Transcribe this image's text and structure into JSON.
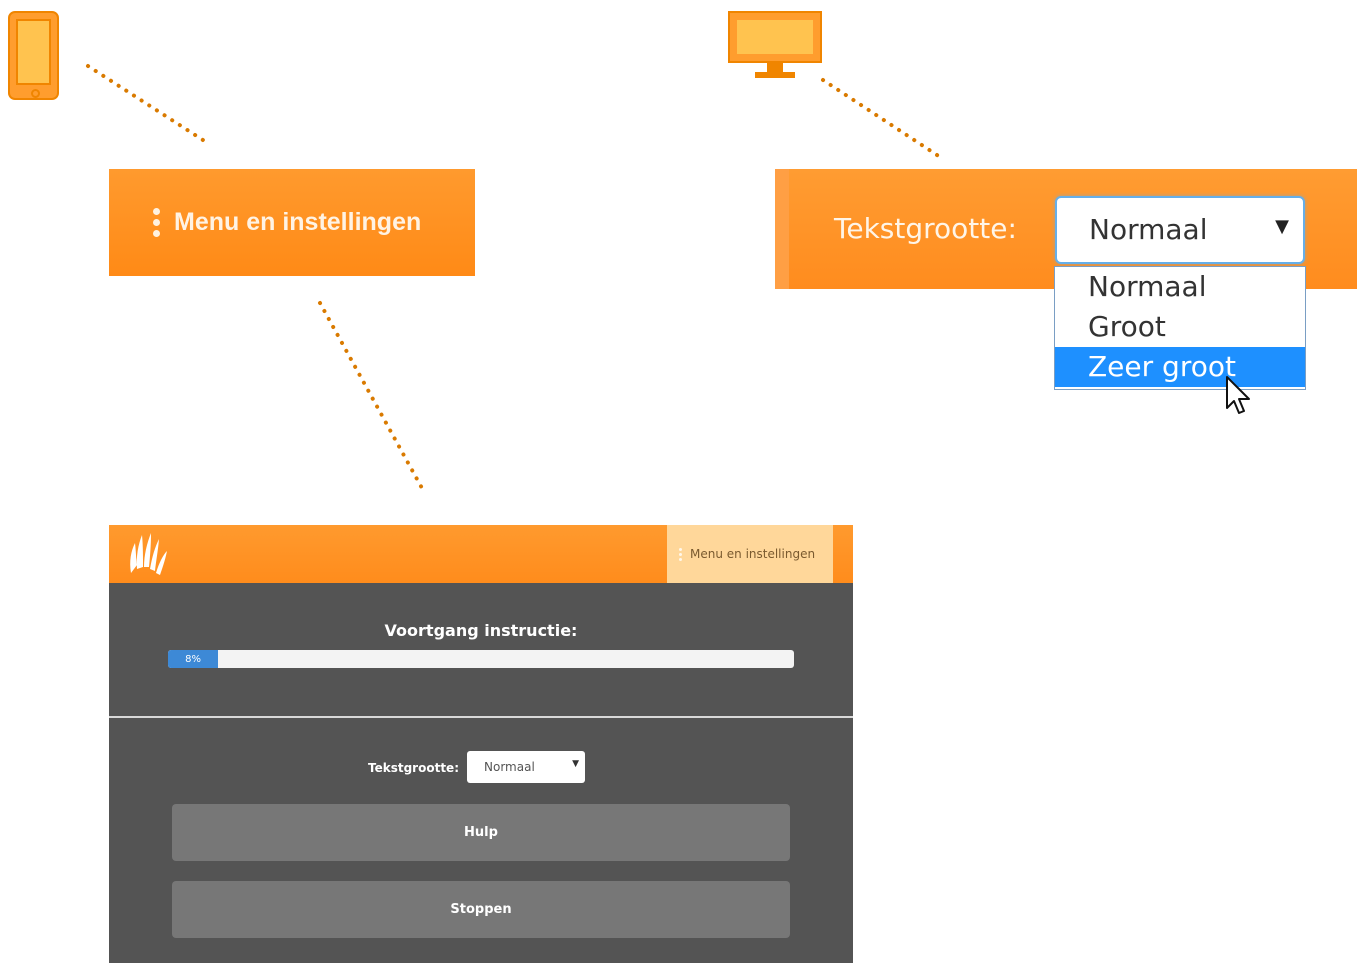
{
  "icons": {
    "phone": "phone-icon",
    "monitor": "monitor-icon",
    "kebab": "vertical-dots-icon",
    "cursor": "mouse-pointer-icon",
    "logo": "hands-logo-icon"
  },
  "colors": {
    "brand_orange": "#ff8c1c",
    "device_orange": "#f08500",
    "selected_option": "#1e90ff",
    "progress_blue": "#3d89d6",
    "panel_dark": "#545454",
    "button_gray": "#777777"
  },
  "mobile_callout": {
    "menu_label": "Menu en instellingen"
  },
  "desktop_callout": {
    "text_size_label": "Tekstgrootte:",
    "selected_value": "Normaal",
    "options": [
      "Normaal",
      "Groot",
      "Zeer groot"
    ],
    "highlighted_option": "Zeer groot"
  },
  "app": {
    "menu_label": "Menu en instellingen",
    "progress_title": "Voortgang instructie:",
    "progress_percent": 8,
    "progress_text": "8%",
    "text_size_label": "Tekstgrootte:",
    "text_size_value": "Normaal",
    "buttons": {
      "help": "Hulp",
      "stop": "Stoppen"
    }
  }
}
